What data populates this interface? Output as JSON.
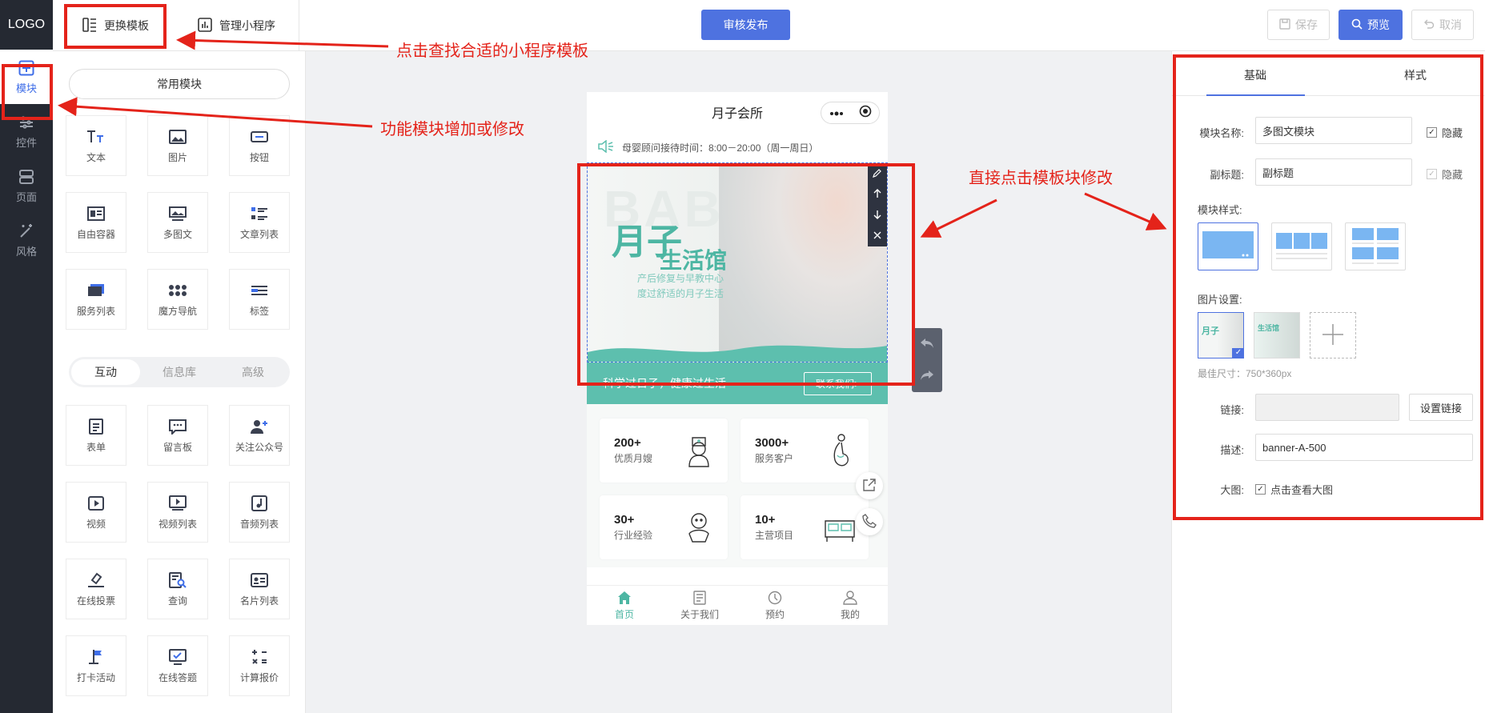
{
  "rail": {
    "logo": "LOGO",
    "items": [
      {
        "label": "模块",
        "icon": "plus-square-icon"
      },
      {
        "label": "控件",
        "icon": "sliders-icon"
      },
      {
        "label": "页面",
        "icon": "server-icon"
      },
      {
        "label": "风格",
        "icon": "magic-wand-icon"
      }
    ]
  },
  "topbar": {
    "tab_template": "更换模板",
    "tab_manage": "管理小程序",
    "publish": "审核发布",
    "save": "保存",
    "preview": "预览",
    "cancel": "取消"
  },
  "panel": {
    "common_label": "常用模块",
    "common": [
      {
        "label": "文本",
        "icon": "text-icon"
      },
      {
        "label": "图片",
        "icon": "image-icon"
      },
      {
        "label": "按钮",
        "icon": "button-icon"
      },
      {
        "label": "自由容器",
        "icon": "container-icon"
      },
      {
        "label": "多图文",
        "icon": "multi-image-text-icon"
      },
      {
        "label": "文章列表",
        "icon": "article-list-icon"
      },
      {
        "label": "服务列表",
        "icon": "service-list-icon"
      },
      {
        "label": "魔方导航",
        "icon": "cube-nav-icon"
      },
      {
        "label": "标签",
        "icon": "tag-icon"
      }
    ],
    "segments": [
      "互动",
      "信息库",
      "高级"
    ],
    "interactive": [
      {
        "label": "表单",
        "icon": "form-icon"
      },
      {
        "label": "留言板",
        "icon": "message-board-icon"
      },
      {
        "label": "关注公众号",
        "icon": "follow-user-icon"
      },
      {
        "label": "视频",
        "icon": "video-icon"
      },
      {
        "label": "视频列表",
        "icon": "video-list-icon"
      },
      {
        "label": "音频列表",
        "icon": "audio-list-icon"
      },
      {
        "label": "在线投票",
        "icon": "vote-icon"
      },
      {
        "label": "查询",
        "icon": "query-icon"
      },
      {
        "label": "名片列表",
        "icon": "card-list-icon"
      },
      {
        "label": "打卡活动",
        "icon": "checkin-flag-icon"
      },
      {
        "label": "在线答题",
        "icon": "quiz-icon"
      },
      {
        "label": "计算报价",
        "icon": "calculator-icon"
      }
    ]
  },
  "phone": {
    "title": "月子会所",
    "notice": "母婴顾问接待时间：8:00－20:00（周一周日）",
    "banner": {
      "bg_text": "BABY",
      "title1": "月子",
      "title2": "生活馆",
      "sub1": "产后修复与早教中心",
      "sub2": "度过舒适的月子生活"
    },
    "contact_text": "科学过日子，健康过生活",
    "contact_btn": "联系我们>",
    "stats": [
      {
        "value": "200+",
        "label": "优质月嫂"
      },
      {
        "value": "3000+",
        "label": "服务客户"
      },
      {
        "value": "30+",
        "label": "行业经验"
      },
      {
        "value": "10+",
        "label": "主营项目"
      }
    ],
    "tabs": [
      "首页",
      "关于我们",
      "预约",
      "我的"
    ]
  },
  "right": {
    "tab_basic": "基础",
    "tab_style": "样式",
    "name_label": "模块名称:",
    "name_value": "多图文模块",
    "hide_label": "隐藏",
    "subtitle_label": "副标题:",
    "subtitle_placeholder": "副标题",
    "style_label": "模块样式:",
    "image_label": "图片设置:",
    "best_size": "最佳尺寸：750*360px",
    "link_label": "链接:",
    "set_link": "设置链接",
    "desc_label": "描述:",
    "desc_value": "banner-A-500",
    "bigimg_label": "大图:",
    "bigimg_text": "点击查看大图"
  },
  "annotations": {
    "a1": "点击查找合适的小程序模板",
    "a2": "功能模块增加或修改",
    "a3": "直接点击模板块修改"
  },
  "colors": {
    "accent": "#4e72e0",
    "theme": "#5dbfae",
    "annotation": "#e4231a",
    "rail": "#252932"
  }
}
